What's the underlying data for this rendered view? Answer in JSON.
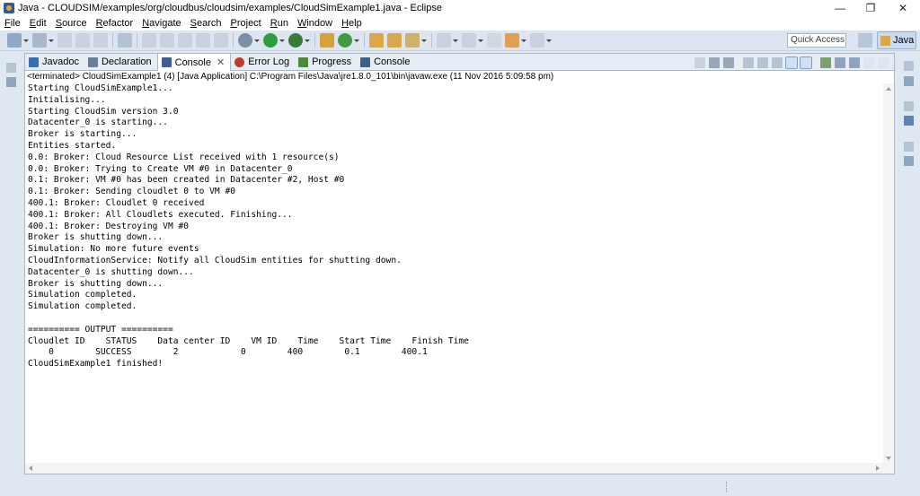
{
  "window": {
    "title": "Java - CLOUDSIM/examples/org/cloudbus/cloudsim/examples/CloudSimExample1.java - Eclipse",
    "minimize": "—",
    "maximize": "❐",
    "close": "✕"
  },
  "menu": [
    "File",
    "Edit",
    "Source",
    "Refactor",
    "Navigate",
    "Search",
    "Project",
    "Run",
    "Window",
    "Help"
  ],
  "toolbar": {
    "quick_access_placeholder": "Quick Access",
    "perspective_label": "Java"
  },
  "tabs": [
    {
      "label": "Javadoc",
      "icon": "javadoc-icon",
      "color": "#3b6fb0"
    },
    {
      "label": "Declaration",
      "icon": "declaration-icon",
      "color": "#6a7f99"
    },
    {
      "label": "Console",
      "icon": "console-icon",
      "color": "#3e5f8a",
      "active": true,
      "close": "✕"
    },
    {
      "label": "Error Log",
      "icon": "error-log-icon",
      "color": "#c0392b"
    },
    {
      "label": "Progress",
      "icon": "progress-icon",
      "color": "#4a8a3c"
    },
    {
      "label": "Console",
      "icon": "console-icon",
      "color": "#3e5f8a"
    }
  ],
  "console": {
    "status": "<terminated> CloudSimExample1 (4) [Java Application] C:\\Program Files\\Java\\jre1.8.0_101\\bin\\javaw.exe (11 Nov 2016 5:09:58 pm)",
    "lines": [
      "Starting CloudSimExample1...",
      "Initialising...",
      "Starting CloudSim version 3.0",
      "Datacenter_0 is starting...",
      "Broker is starting...",
      "Entities started.",
      "0.0: Broker: Cloud Resource List received with 1 resource(s)",
      "0.0: Broker: Trying to Create VM #0 in Datacenter_0",
      "0.1: Broker: VM #0 has been created in Datacenter #2, Host #0",
      "0.1: Broker: Sending cloudlet 0 to VM #0",
      "400.1: Broker: Cloudlet 0 received",
      "400.1: Broker: All Cloudlets executed. Finishing...",
      "400.1: Broker: Destroying VM #0",
      "Broker is shutting down...",
      "Simulation: No more future events",
      "CloudInformationService: Notify all CloudSim entities for shutting down.",
      "Datacenter_0 is shutting down...",
      "Broker is shutting down...",
      "Simulation completed.",
      "Simulation completed.",
      "",
      "========== OUTPUT ==========",
      "Cloudlet ID    STATUS    Data center ID    VM ID    Time    Start Time    Finish Time",
      "    0        SUCCESS        2            0        400        0.1        400.1",
      "CloudSimExample1 finished!"
    ]
  },
  "colors": {
    "accent": "#2c5b9a",
    "run": "#2e9e3a",
    "debug": "#3a7bd5",
    "perspective_bg": "#c9dbf0"
  }
}
